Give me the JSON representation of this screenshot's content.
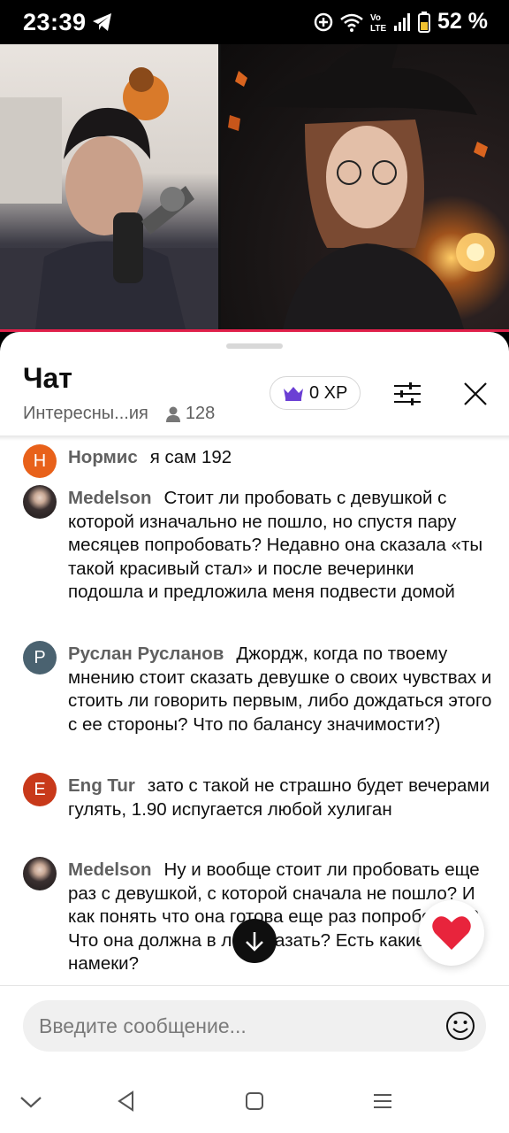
{
  "status_bar": {
    "time": "23:39",
    "battery": "52 %",
    "icons": [
      "telegram-icon",
      "data-saver-icon",
      "wifi-icon",
      "volte-icon",
      "signal-icon",
      "battery-icon"
    ]
  },
  "chat": {
    "title": "Чат",
    "subtitle": "Интересны...ия",
    "viewers": "128",
    "xp_label": "0 XP",
    "messages": [
      {
        "author": "Нормис",
        "avatar_letter": "Н",
        "avatar_color": "#e8611a",
        "text": "я сам 192"
      },
      {
        "author": "Medelson",
        "avatar_letter": "",
        "avatar_color": "#2b2424",
        "text": "Стоит ли пробовать с девушкой с которой изначально не пошло, но спустя пару месяцев попробовать? Недавно она сказала «ты такой красивый стал» и после вечеринки подошла и предложила меня подвести домой"
      },
      {
        "author": "Руслан Русланов",
        "avatar_letter": "Р",
        "avatar_color": "#4a6270",
        "text": "Джордж, когда по твоему мнению стоит сказать девушке о своих чувствах и стоить ли говорить первым, либо дождаться этого с ее стороны? Что по балансу значимости?)"
      },
      {
        "author": "Eng Tur",
        "avatar_letter": "E",
        "avatar_color": "#c8391a",
        "text": "зато с такой не страшно будет вечерами гулять, 1.90 испугается любой хулиган"
      },
      {
        "author": "Medelson",
        "avatar_letter": "",
        "avatar_color": "#2b2424",
        "text": "Ну и вообще стоит ли пробовать еще раз с девушкой, с которой сначала не пошло? И как понять что она готова еще раз попробовать? Что она должна в лоб сказать? Есть какие то намеки?"
      }
    ],
    "input_placeholder": "Введите сообщение..."
  },
  "colors": {
    "accent_red": "#e0204a",
    "crown": "#6b3fd4"
  }
}
